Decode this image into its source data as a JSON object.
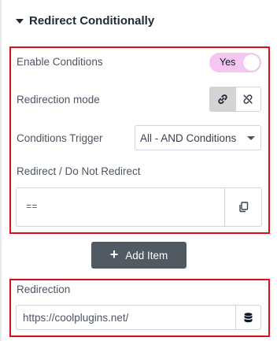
{
  "section": {
    "title": "Redirect Conditionally"
  },
  "enable_conditions": {
    "label": "Enable Conditions",
    "toggle_label": "Yes",
    "toggle_on": true,
    "accent_color": "#f5c6ef"
  },
  "redirection_mode": {
    "label": "Redirection mode",
    "options": [
      {
        "icon": "link-icon",
        "active": true
      },
      {
        "icon": "unlink-icon",
        "active": false
      }
    ]
  },
  "conditions_trigger": {
    "label": "Conditions Trigger",
    "selected": "All - AND Conditions"
  },
  "redirect_rule": {
    "label": "Redirect / Do Not Redirect",
    "value": "==",
    "action_icon": "copy-icon"
  },
  "add_item": {
    "label": "Add Item",
    "icon": "plus-icon"
  },
  "redirection": {
    "label": "Redirection",
    "value": "https://coolplugins.net/",
    "action_icon": "database-icon"
  },
  "highlight_color": "#e00d1b"
}
